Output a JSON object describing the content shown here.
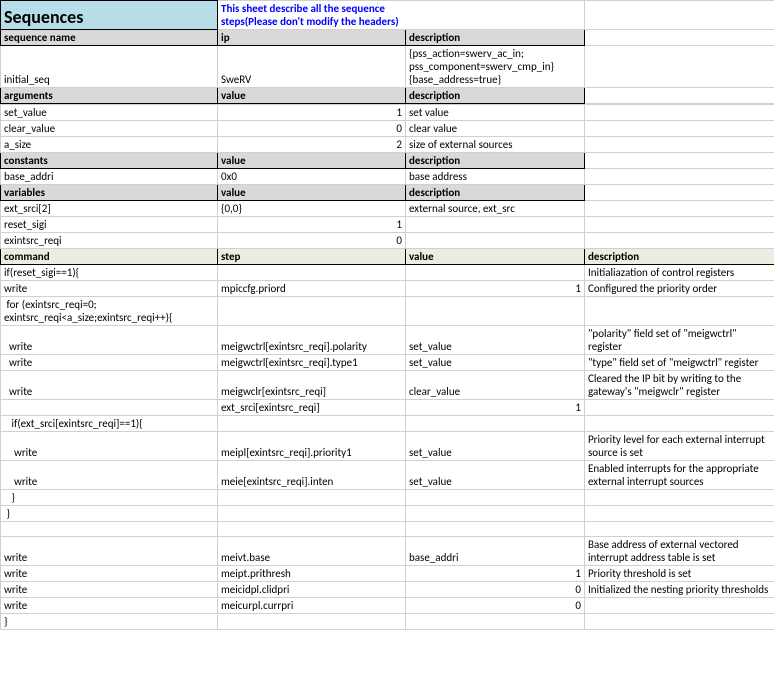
{
  "title": "Sequences",
  "subtitle": "This sheet describe all the sequence steps(Please don't modify the headers)",
  "headers": {
    "seq_name": "sequence name",
    "ip": "ip",
    "description": "description",
    "arguments": "arguments",
    "value": "value",
    "constants": "constants",
    "variables": "variables",
    "command": "command",
    "step": "step"
  },
  "seq": {
    "name": "initial_seq",
    "ip": "SweRV",
    "desc": "{pss_action=swerv_ac_in; pss_component=swerv_cmp_in} {base_address=true}"
  },
  "arguments": [
    {
      "name": "set_value",
      "value": "1",
      "desc": "set value"
    },
    {
      "name": "clear_value",
      "value": "0",
      "desc": "clear value"
    },
    {
      "name": "a_size",
      "value": "2",
      "desc": "size of external sources"
    }
  ],
  "constants": [
    {
      "name": "base_addri",
      "value": "0x0",
      "desc": "base address"
    }
  ],
  "variables": [
    {
      "name": "ext_srci[2]",
      "value": "{0,0}",
      "desc": "external source, ext_src"
    },
    {
      "name": "reset_sigi",
      "value": "1",
      "desc": ""
    },
    {
      "name": "exintsrc_reqi",
      "value": "0",
      "desc": ""
    }
  ],
  "commands": [
    {
      "cmd": "if(reset_sigi==1){",
      "step": "",
      "val": "",
      "desc": "Initialiazation of control registers"
    },
    {
      "cmd": "write",
      "step": "mpiccfg.priord",
      "val": "1",
      "desc": "Configured the priority order",
      "num": true
    },
    {
      "cmd": " for (exintsrc_reqi=0; exintsrc_reqi<a_size;exintsrc_reqi++){",
      "step": "",
      "val": "",
      "desc": ""
    },
    {
      "cmd": "  write",
      "step": "meigwctrl[exintsrc_reqi].polarity",
      "val": "set_value",
      "desc": "\"polarity\" field set of \"meigwctrl\" register"
    },
    {
      "cmd": "  write",
      "step": "meigwctrl[exintsrc_reqi].type1",
      "val": "set_value",
      "desc": "\"type\" field set of \"meigwctrl\" register"
    },
    {
      "cmd": "  write",
      "step": "meigwclr[exintsrc_reqi]",
      "val": "clear_value",
      "desc": "Cleared the IP bit by writing to the gateway's \"meigwclr\" register"
    },
    {
      "cmd": "",
      "step": "ext_srci[exintsrc_reqi]",
      "val": "1",
      "desc": "",
      "num": true
    },
    {
      "cmd": "   if(ext_srci[exintsrc_reqi]==1){",
      "step": "",
      "val": "",
      "desc": ""
    },
    {
      "cmd": "    write",
      "step": "meipl[exintsrc_reqi].priority1",
      "val": "set_value",
      "desc": "Priority level for each external interrupt source is set"
    },
    {
      "cmd": "    write",
      "step": "meie[exintsrc_reqi].inten",
      "val": "set_value",
      "desc": "Enabled interrupts for the appropriate external interrupt sources"
    },
    {
      "cmd": "   }",
      "step": "",
      "val": "",
      "desc": ""
    },
    {
      "cmd": " }",
      "step": "",
      "val": "",
      "desc": ""
    },
    {
      "cmd": "",
      "step": "",
      "val": "",
      "desc": ""
    },
    {
      "cmd": "write",
      "step": "meivt.base",
      "val": "base_addri",
      "desc": "Base address of external vectored interrupt address table is set"
    },
    {
      "cmd": "write",
      "step": "meipt.prithresh",
      "val": "1",
      "desc": "Priority threshold is set",
      "num": true
    },
    {
      "cmd": "write",
      "step": "meicidpl.clidpri",
      "val": "0",
      "desc": "Initialized the nesting priority thresholds",
      "num": true
    },
    {
      "cmd": "write",
      "step": "meicurpl.currpri",
      "val": "0",
      "desc": "",
      "num": true
    },
    {
      "cmd": "}",
      "step": "",
      "val": "",
      "desc": ""
    }
  ]
}
